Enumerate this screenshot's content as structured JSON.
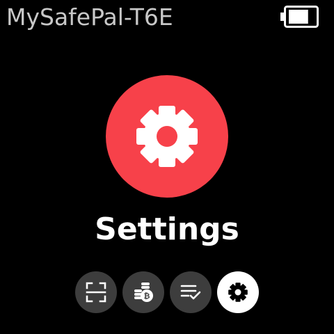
{
  "status_bar": {
    "device_name": "MySafePal-T6E",
    "battery_icon": "battery-icon",
    "battery_level": 0.75
  },
  "hero": {
    "icon": "gear-icon",
    "circle_color": "#f7414a",
    "title": "Settings"
  },
  "nav": {
    "items": [
      {
        "icon": "scan-icon",
        "active": false
      },
      {
        "icon": "coins-icon",
        "active": false
      },
      {
        "icon": "checklist-icon",
        "active": false
      },
      {
        "icon": "gear-icon",
        "active": true
      }
    ]
  },
  "colors": {
    "background": "#000000",
    "accent": "#f7414a",
    "inactive_dot": "#3d3d3d",
    "active_dot": "#ffffff"
  }
}
